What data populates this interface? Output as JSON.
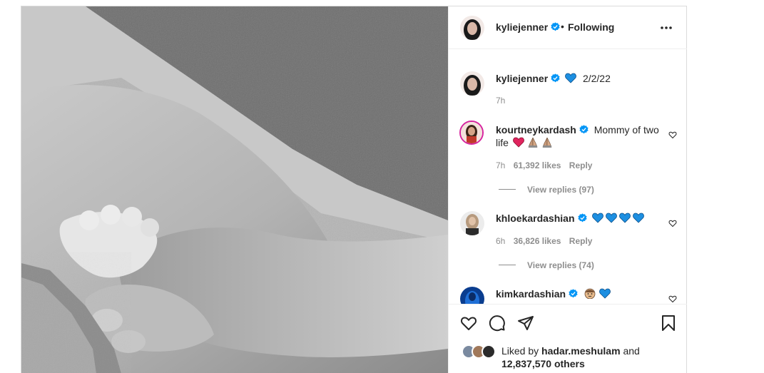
{
  "post": {
    "author": "kyliejenner",
    "follow_status": "Following",
    "separator": "•"
  },
  "caption": {
    "username": "kyliejenner",
    "text": "2/2/22",
    "time": "7h"
  },
  "comments": [
    {
      "username": "kourtneykardash",
      "text_line1": "Mommy of two",
      "text_line2": "life",
      "time": "7h",
      "likes": "61,392 likes",
      "reply_label": "Reply",
      "view_replies": "View replies (97)"
    },
    {
      "username": "khloekardashian",
      "time": "6h",
      "likes": "36,826 likes",
      "reply_label": "Reply",
      "view_replies": "View replies (74)"
    },
    {
      "username": "kimkardashian"
    }
  ],
  "liked_by": {
    "prefix": "Liked by",
    "user": "hadar.meshulam",
    "conj": "and",
    "others": "12,837,570 others"
  },
  "icons": {
    "more": "more-options-icon",
    "like": "heart-icon",
    "comment": "comment-icon",
    "share": "share-icon",
    "save": "bookmark-icon",
    "verified": "verified-badge-icon"
  },
  "colors": {
    "verified_blue": "#0095f6",
    "blue_heart": "#1d8fe1",
    "red_heart": "#e0245e",
    "text_secondary": "#8e8e8e"
  }
}
